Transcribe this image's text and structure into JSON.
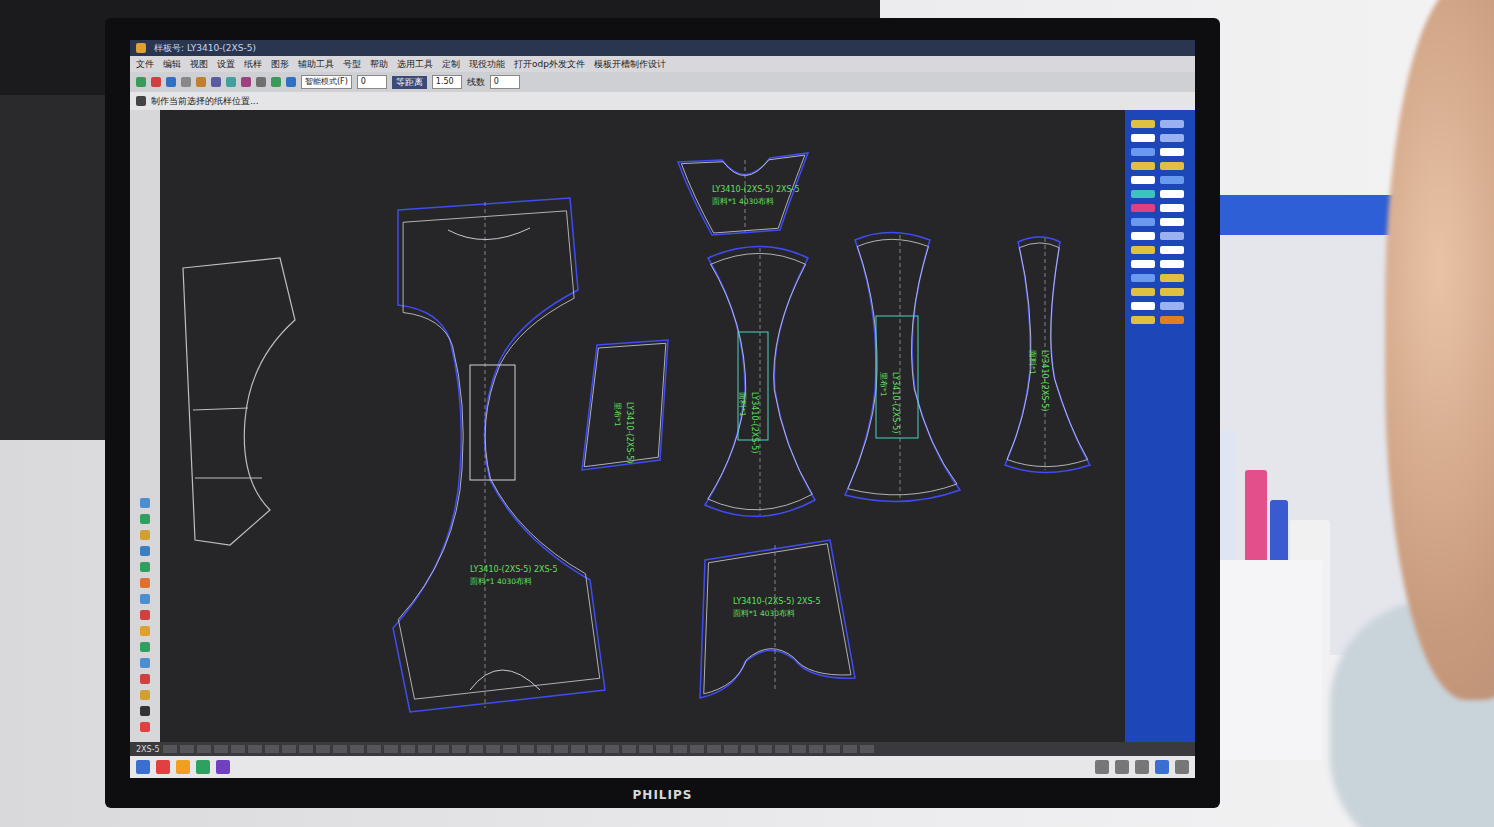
{
  "window": {
    "title": "样板号: LY3410-(2XS-5)"
  },
  "menu": [
    "文件",
    "编辑",
    "视图",
    "设置",
    "纸样",
    "图形",
    "辅助工具",
    "号型",
    "帮助",
    "选用工具",
    "定制",
    "现役功能",
    "打开odp外发文件",
    "模板开槽制作设计"
  ],
  "toolbar": {
    "combo": "智能模式(F)",
    "field1": "0",
    "button": "等距离",
    "field2": "1.50",
    "label": "线数",
    "field3": "0"
  },
  "hint": "制作当前选择的纸样位置...",
  "pieces": [
    {
      "label": "LY3410-(2XS-5)  2XS-5",
      "note": "面料*1  4030布料"
    },
    {
      "label": "LY3410-(2XS-5)",
      "note": "里布*1"
    },
    {
      "label": "LY3410-(2XS-5)  2XS-5",
      "note": "面料*1  4030布料"
    },
    {
      "label": "LY3410-(2XS-5)",
      "note": "面料*1"
    },
    {
      "label": "LY3410-(2XS-5)",
      "note": "里布*1"
    },
    {
      "label": "LY3410-(2XS-5)",
      "note": "面料*1"
    },
    {
      "label": "LY3410-(2XS-5)  2XS-5",
      "note": "面料*1  4030布料"
    }
  ],
  "status": {
    "size": "2XS-5"
  },
  "monitor": {
    "brand": "PHILIPS"
  }
}
